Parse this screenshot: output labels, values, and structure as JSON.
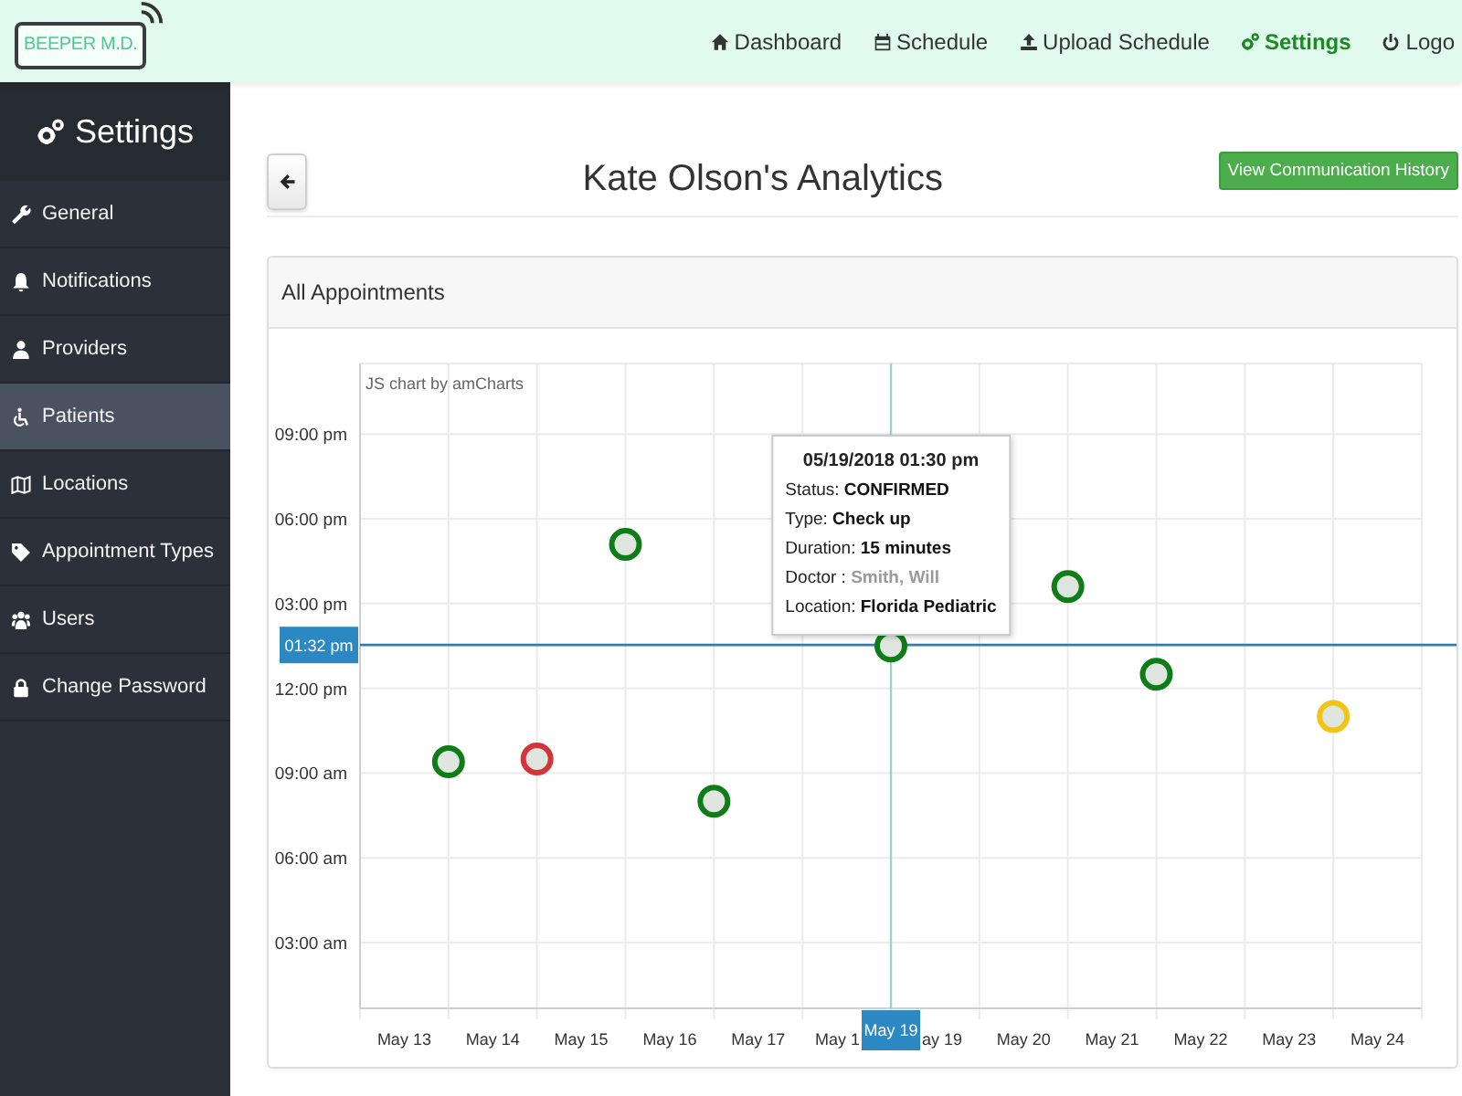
{
  "header": {
    "logo": "BEEPER M.D.",
    "nav": [
      {
        "label": "Dashboard",
        "selected": false
      },
      {
        "label": "Schedule",
        "selected": false
      },
      {
        "label": "Upload Schedule",
        "selected": false
      },
      {
        "label": "Settings",
        "selected": true
      },
      {
        "label": "Logo",
        "selected": false
      }
    ]
  },
  "sidebar": {
    "title": "Settings",
    "items": [
      {
        "label": "General",
        "selected": false
      },
      {
        "label": "Notifications",
        "selected": false
      },
      {
        "label": "Providers",
        "selected": false
      },
      {
        "label": "Patients",
        "selected": true
      },
      {
        "label": "Locations",
        "selected": false
      },
      {
        "label": "Appointment Types",
        "selected": false
      },
      {
        "label": "Users",
        "selected": false
      },
      {
        "label": "Change Password",
        "selected": false
      }
    ]
  },
  "page": {
    "title": "Kate Olson's Analytics",
    "action_button": "View Communication History"
  },
  "panel": {
    "title": "All Appointments",
    "credit": "JS chart by amCharts",
    "chart_data": {
      "type": "scatter",
      "grid": true,
      "categories": [
        null,
        "May 13",
        null,
        "May 14",
        null,
        "May 15",
        null,
        "May 16",
        null,
        "May 17",
        null,
        "May 1",
        null,
        "ay 19",
        null,
        "May 20",
        null,
        "May 21",
        null,
        "May 22",
        null,
        "May 23",
        null,
        "May 24",
        null
      ],
      "ylim": [
        0.67,
        23.5
      ],
      "yticks": [
        {
          "value": 3,
          "label": "03:00 am"
        },
        {
          "value": 6,
          "label": "06:00 am"
        },
        {
          "value": 9,
          "label": "09:00 am"
        },
        {
          "value": 12,
          "label": "12:00 pm"
        },
        {
          "value": 15,
          "label": "03:00 pm"
        },
        {
          "value": 18,
          "label": "06:00 pm"
        },
        {
          "value": 21,
          "label": "09:00 pm"
        }
      ],
      "series": [
        {
          "color": "#0f7d17",
          "values": [
            null,
            null,
            9.4,
            null,
            null,
            null,
            17.1,
            null,
            8.0,
            null,
            null,
            null,
            13.5,
            null,
            null,
            null,
            15.6,
            null,
            12.5,
            null,
            null,
            null,
            null,
            null,
            null
          ]
        },
        {
          "color": "#d3343a",
          "values": [
            null,
            null,
            null,
            null,
            9.5,
            null,
            null,
            null,
            null,
            null,
            null,
            null,
            null,
            null,
            null,
            null,
            null,
            null,
            null,
            null,
            null,
            null,
            null,
            null,
            null
          ]
        },
        {
          "color": "#f2c418",
          "values": [
            null,
            null,
            null,
            null,
            null,
            null,
            null,
            null,
            null,
            null,
            null,
            null,
            null,
            null,
            null,
            null,
            null,
            null,
            null,
            null,
            null,
            null,
            11.0,
            null,
            null
          ]
        }
      ],
      "ref_lines": [
        {
          "axis": "y",
          "value": 13.5333
        }
      ]
    },
    "cursor": {
      "date_label": "May 19",
      "time_label": "01:32 pm"
    },
    "tooltip": {
      "title": "05/19/2018 01:30 pm",
      "lines": [
        {
          "label": "Status:",
          "value": "CONFIRMED",
          "muted": false
        },
        {
          "label": "Type:",
          "value": "Check up",
          "muted": false
        },
        {
          "label": "Duration:",
          "value": "15 minutes",
          "muted": false
        },
        {
          "label": "Doctor :",
          "value": "Smith, Will",
          "muted": true
        },
        {
          "label": "Location:",
          "value": "Florida Pediatric",
          "muted": false
        }
      ]
    }
  }
}
